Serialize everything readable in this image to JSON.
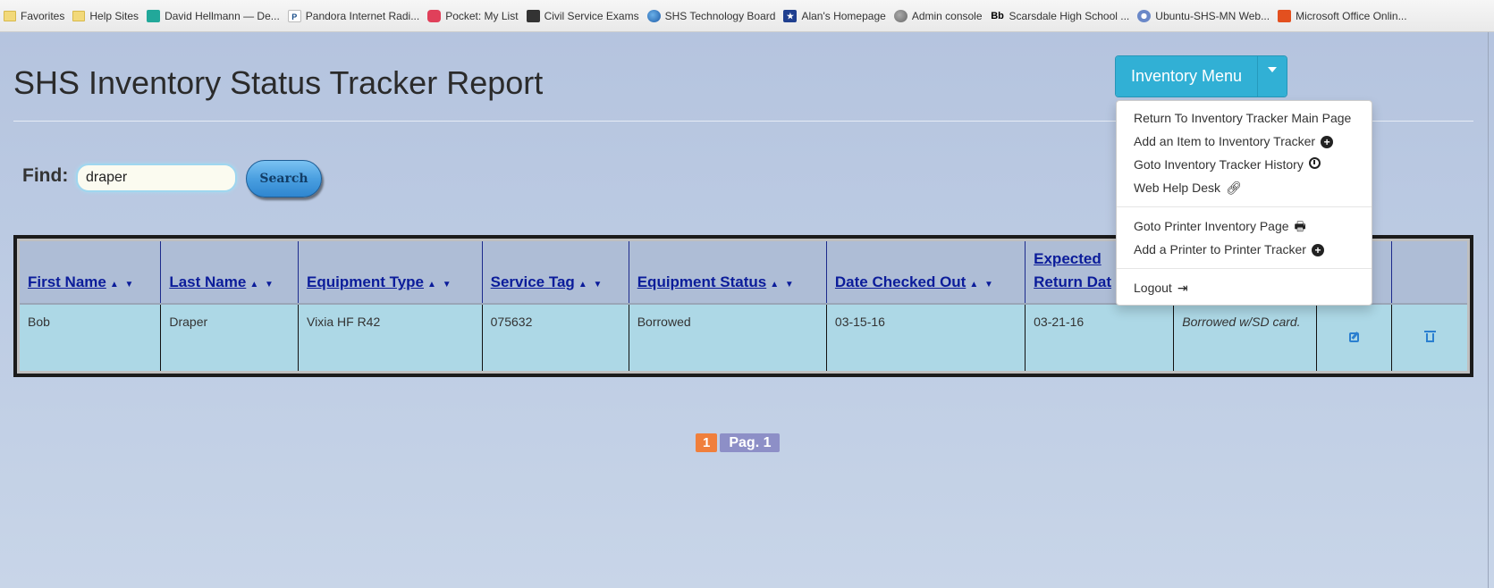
{
  "favorites": [
    {
      "label": "Favorites",
      "icon": "folder-icon"
    },
    {
      "label": "Help Sites",
      "icon": "folder-icon"
    },
    {
      "label": "David Hellmann — De...",
      "icon": "site-icon"
    },
    {
      "label": "Pandora Internet Radi...",
      "icon": "pandora-icon"
    },
    {
      "label": "Pocket: My List",
      "icon": "pocket-icon"
    },
    {
      "label": "Civil Service Exams",
      "icon": "site-icon"
    },
    {
      "label": "SHS Technology Board",
      "icon": "globe-icon"
    },
    {
      "label": "Alan's Homepage",
      "icon": "site-icon"
    },
    {
      "label": "Admin console",
      "icon": "globe-icon"
    },
    {
      "label": "Scarsdale High School ...",
      "icon": "blackboard-icon"
    },
    {
      "label": "Ubuntu-SHS-MN Web...",
      "icon": "globe-icon"
    },
    {
      "label": "Microsoft Office Onlin...",
      "icon": "office-icon"
    }
  ],
  "page": {
    "title": "SHS Inventory Status Tracker Report"
  },
  "menu": {
    "button_label": "Inventory Menu",
    "items_group1": [
      "Return To Inventory Tracker Main Page",
      "Add an Item to Inventory Tracker",
      "Goto Inventory Tracker History",
      "Web Help Desk"
    ],
    "items_group2": [
      "Goto Printer Inventory Page",
      "Add a Printer to Printer Tracker"
    ],
    "items_group3": [
      "Logout"
    ]
  },
  "find": {
    "label": "Find:",
    "value": "draper",
    "button": "Search"
  },
  "table": {
    "headers": {
      "first_name": "First Name",
      "last_name": "Last Name",
      "equipment_type": "Equipment Type",
      "service_tag": "Service Tag",
      "equipment_status": "Equipment Status",
      "date_checked_out": "Date Checked Out",
      "expected_return_line1": "Expected",
      "expected_return_line2": "Return Dat"
    },
    "sort_glyph": "▲ ▼",
    "rows": [
      {
        "first_name": "Bob",
        "last_name": "Draper",
        "equipment_type": "Vixia HF R42",
        "service_tag": "075632",
        "equipment_status": "Borrowed",
        "date_checked_out": "03-15-16",
        "expected_return": "03-21-16",
        "notes": "Borrowed w/SD card."
      }
    ]
  },
  "pagination": {
    "current": "1",
    "label": "Pag. 1"
  },
  "colors": {
    "menu_button": "#31b0d5",
    "header_link": "#0b1c9a",
    "row_background": "#add8e6",
    "page_number": "#f07f3c"
  }
}
